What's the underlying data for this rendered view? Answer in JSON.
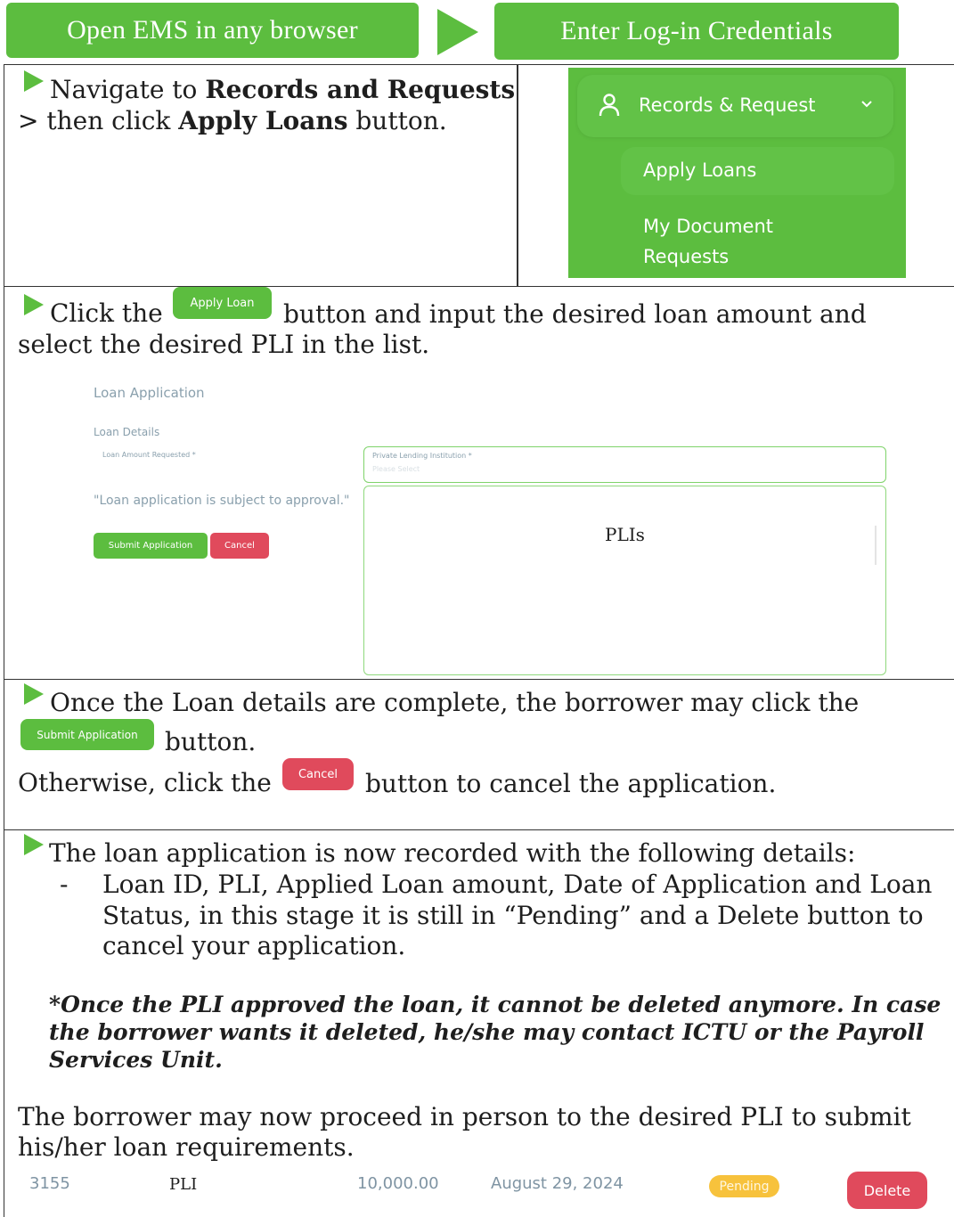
{
  "colors": {
    "brand_green": "#5cbd3f",
    "danger_red": "#e04a5c",
    "pending_yellow": "#f7c23c",
    "muted_text": "#7f94a3"
  },
  "banners": {
    "step1": "Open EMS in any browser",
    "step2": "Enter Log-in Credentials",
    "arrow_icon": "play-arrow-icon"
  },
  "section1": {
    "line1_pre": "Navigate to ",
    "line1_bold": "Records and Requests",
    "line2_pre": "> then click ",
    "line2_bold": "Apply Loans",
    "line2_post": " button.",
    "sidebar": {
      "records_label": "Records & Request",
      "user_icon": "user-icon",
      "chevron_icon": "chevron-down-icon",
      "apply_loans": "Apply Loans",
      "my_document_line1": "My Document",
      "my_document_line2": "Requests"
    }
  },
  "section2": {
    "text_pre": "Click the",
    "inline_button": "Apply Loan",
    "text_post": "button and input the desired loan amount and",
    "text_line2": "select the desired PLI in the list.",
    "form": {
      "title": "Loan Application",
      "subtitle": "Loan Details",
      "amount_label": "Loan Amount Requested *",
      "pli_label": "Private Lending Institution *",
      "pli_placeholder": "Please Select",
      "approval_note": "\"Loan application is subject to approval.\"",
      "submit_label": "Submit Application",
      "cancel_label": "Cancel",
      "list_header": "PLIs"
    }
  },
  "section3": {
    "line1": "Once the Loan details are complete, the borrower may click the",
    "submit_button": "Submit Application",
    "line2_post": "button.",
    "line3_pre": "Otherwise, click the",
    "cancel_button": "Cancel",
    "line3_post": "button to cancel the application."
  },
  "section4": {
    "intro": "The loan application is now recorded with the following details:",
    "bullet_dash": "-",
    "bullet_line1": "Loan ID, PLI, Applied Loan amount, Date of Application and Loan",
    "bullet_line2": "Status, in this stage it is still in “Pending” and a Delete button to",
    "bullet_line3": "cancel your application.",
    "note_line1": "*Once the PLI approved the loan, it cannot be deleted anymore. In case",
    "note_line2": "the borrower wants it deleted, he/she may contact ICTU or the Payroll",
    "note_line3": "Services Unit.",
    "proceed_line1": "The borrower may now proceed in person to the desired PLI to submit",
    "proceed_line2": "his/her loan requirements.",
    "record": {
      "loan_id": "3155",
      "pli": "PLI",
      "amount": "10,000.00",
      "date": "August 29, 2024",
      "status": "Pending",
      "delete_label": "Delete"
    }
  }
}
